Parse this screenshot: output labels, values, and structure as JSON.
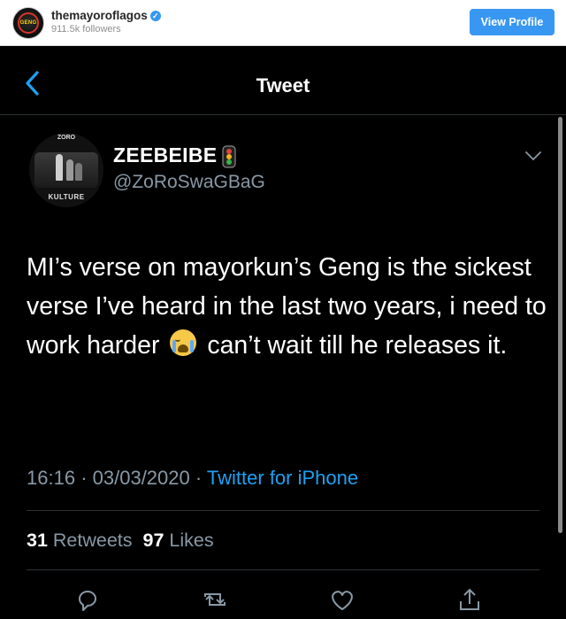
{
  "instagram": {
    "avatar_text": "GENG",
    "username": "themayoroflagos",
    "followers": "911.5k followers",
    "view_profile_label": "View Profile",
    "verified_icon": "verified-badge-icon",
    "accent_color": "#3897f0"
  },
  "tweet": {
    "header_title": "Tweet",
    "display_name": "ZEEBEIBE",
    "handle": "@ZoRoSwaGBaG",
    "avatar_text_top": "ZORO",
    "avatar_text_bottom": "KULTURE",
    "text_part1": "MI’s verse on mayorkun’s Geng is the sickest verse I’ve heard in the last two years, i need to work harder",
    "text_part2": "can’t wait till he releases it.",
    "emoji_icon": "crying-face-icon",
    "time": "16:16",
    "date": "03/03/2020",
    "separator": "·",
    "source": "Twitter for iPhone",
    "retweets_count": "31",
    "retweets_label": "Retweets",
    "likes_count": "97",
    "likes_label": "Likes",
    "link_color": "#1da1f2",
    "muted_color": "#8899a6"
  }
}
